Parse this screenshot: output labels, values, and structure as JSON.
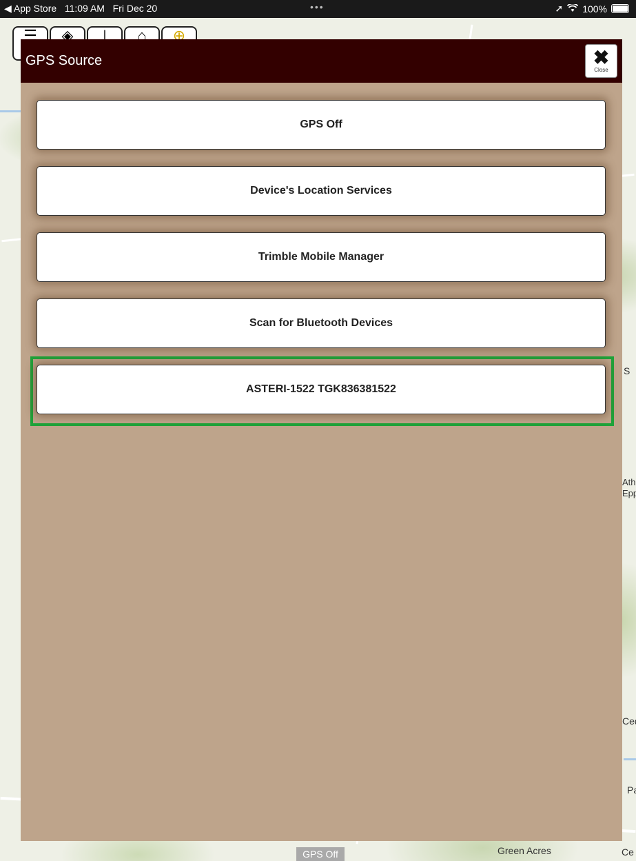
{
  "status_bar": {
    "back_app": "◀ App Store",
    "time": "11:09 AM",
    "date": "Fri Dec 20",
    "multitask_dots": "•••",
    "battery_percent": "100%"
  },
  "modal": {
    "title": "GPS Source",
    "close_label": "Close",
    "options": [
      {
        "label": "GPS Off",
        "highlighted": false
      },
      {
        "label": "Device's Location Services",
        "highlighted": false
      },
      {
        "label": "Trimble Mobile Manager",
        "highlighted": false
      },
      {
        "label": "Scan for Bluetooth Devices",
        "highlighted": false
      },
      {
        "label": "ASTERI-1522 TGK836381522",
        "highlighted": true
      }
    ],
    "highlight_color": "#1ea33a",
    "header_color": "#330000",
    "background_color": "#bea48b"
  },
  "map": {
    "gps_status": "GPS Off",
    "labels": [
      "Green Acres",
      "Ce",
      "S",
      "Ath",
      "Epp",
      "Ced",
      "Pa"
    ]
  },
  "toolbar": {
    "icons": [
      "menu-icon",
      "layers-icon",
      "measure-icon",
      "home-icon",
      "locate-icon"
    ]
  }
}
